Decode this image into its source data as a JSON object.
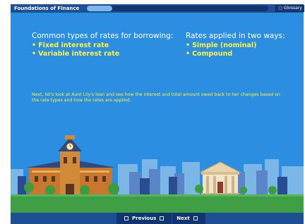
{
  "header": {
    "course_title": "Foundations of Finance",
    "progress_fraction": 0.14,
    "glossary_label": "Glossary"
  },
  "content": {
    "left_heading": "Common types of rates for borrowing:",
    "left_items": [
      "Fixed interest rate",
      "Variable interest rate"
    ],
    "right_heading": "Rates applied in two ways:",
    "right_items": [
      "Simple (nominal)",
      "Compound"
    ],
    "narration": "Next, let's look at Aunt Lily's loan and see how the interest and total amount owed back to her changes based on the rate types and how the rates are applied."
  },
  "footer": {
    "previous_label": "Previous",
    "next_label": "Next"
  },
  "colors": {
    "sky": "#2b8ee1",
    "bar": "#1e4f95",
    "accent_yellow": "#fff23a",
    "grass": "#3f9f45"
  }
}
